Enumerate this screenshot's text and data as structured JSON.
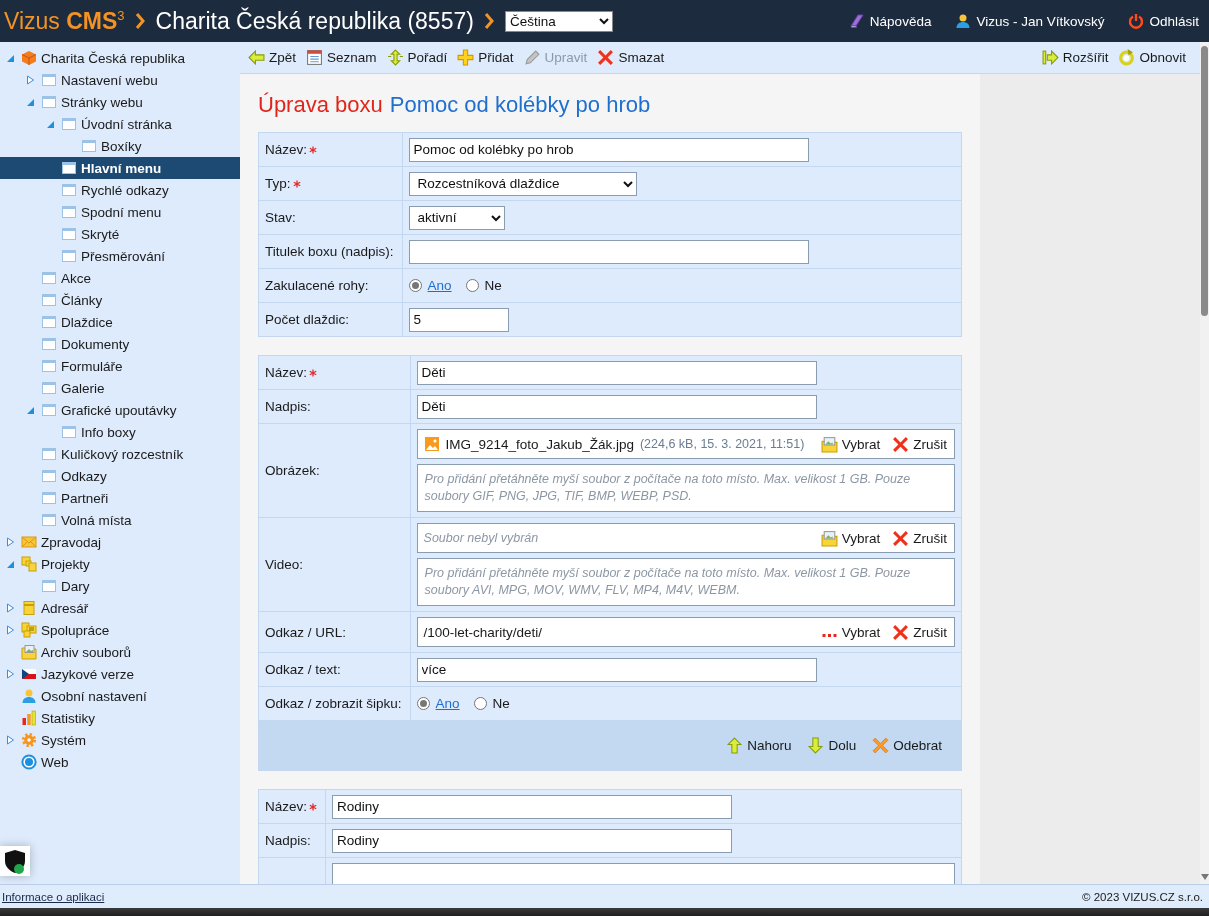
{
  "header": {
    "logo": "Vizus **CMS**$^{3}$",
    "site": "Charita Česká republika (8557)",
    "language": "Čeština",
    "links": [
      {
        "label": "Nápověda",
        "kind": "help"
      },
      {
        "label": "Vizus - Jan Vítkovský",
        "kind": "user"
      },
      {
        "label": "Odhlásit",
        "kind": "logout"
      }
    ]
  },
  "sidebar": {
    "items": [
      {
        "label": "Charita Česká republika",
        "kind": "cube",
        "expanded": true,
        "selected": false,
        "children": [
          {
            "label": "Nastavení webu",
            "kind": "page",
            "expanded": false,
            "selected": false
          },
          {
            "label": "Stránky webu",
            "kind": "page",
            "expanded": true,
            "selected": false,
            "children": [
              {
                "label": "Úvodní stránka",
                "kind": "page",
                "expanded": true,
                "selected": false,
                "children": [
                  {
                    "label": "Boxíky",
                    "kind": "page",
                    "selected": false
                  }
                ]
              },
              {
                "label": "Hlavní menu",
                "kind": "page",
                "selected": true
              },
              {
                "label": "Rychlé odkazy",
                "kind": "page",
                "selected": false
              },
              {
                "label": "Spodní menu",
                "kind": "page",
                "selected": false
              },
              {
                "label": "Skryté",
                "kind": "page",
                "selected": false
              },
              {
                "label": "Přesměrování",
                "kind": "page",
                "selected": false
              }
            ]
          },
          {
            "label": "Akce",
            "kind": "page",
            "selected": false
          },
          {
            "label": "Články",
            "kind": "page",
            "selected": false
          },
          {
            "label": "Dlaždice",
            "kind": "page",
            "selected": false
          },
          {
            "label": "Dokumenty",
            "kind": "page",
            "selected": false
          },
          {
            "label": "Formuláře",
            "kind": "page",
            "selected": false
          },
          {
            "label": "Galerie",
            "kind": "page",
            "selected": false
          },
          {
            "label": "Grafické upoutávky",
            "kind": "page",
            "expanded": true,
            "selected": false,
            "children": [
              {
                "label": "Info boxy",
                "kind": "page",
                "selected": false
              }
            ]
          },
          {
            "label": "Kuličkový rozcestník",
            "kind": "page",
            "selected": false
          },
          {
            "label": "Odkazy",
            "kind": "page",
            "selected": false
          },
          {
            "label": "Partneři",
            "kind": "page",
            "selected": false
          },
          {
            "label": "Volná místa",
            "kind": "page",
            "selected": false
          }
        ]
      },
      {
        "label": "Zpravodaj",
        "kind": "mail",
        "expanded": false,
        "selected": false
      },
      {
        "label": "Projekty",
        "kind": "projects",
        "expanded": true,
        "selected": false,
        "children": [
          {
            "label": "Dary",
            "kind": "page",
            "selected": false
          }
        ]
      },
      {
        "label": "Adresář",
        "kind": "address",
        "expanded": false,
        "selected": false
      },
      {
        "label": "Spolupráce",
        "kind": "collab",
        "expanded": false,
        "selected": false
      },
      {
        "label": "Archiv souborů",
        "kind": "archive",
        "selected": false
      },
      {
        "label": "Jazykové verze",
        "kind": "flag",
        "expanded": false,
        "selected": false
      },
      {
        "label": "Osobní nastavení",
        "kind": "person",
        "selected": false
      },
      {
        "label": "Statistiky",
        "kind": "stats",
        "selected": false
      },
      {
        "label": "Systém",
        "kind": "gear",
        "expanded": false,
        "selected": false
      },
      {
        "label": "Web",
        "kind": "web",
        "selected": false
      }
    ]
  },
  "toolbar": {
    "left": [
      {
        "label": "Zpět",
        "kind": "back",
        "disabled": false
      },
      {
        "label": "Seznam",
        "kind": "list",
        "disabled": false
      },
      {
        "label": "Pořadí",
        "kind": "order",
        "disabled": false
      },
      {
        "label": "Přidat",
        "kind": "add",
        "disabled": false
      },
      {
        "label": "Upravit",
        "kind": "edit",
        "disabled": true
      },
      {
        "label": "Smazat",
        "kind": "delete",
        "disabled": false
      }
    ],
    "right": [
      {
        "label": "Rozšířit",
        "kind": "expand",
        "disabled": false
      },
      {
        "label": "Obnovit",
        "kind": "refresh",
        "disabled": false
      }
    ]
  },
  "heading": {
    "action": "Úprava boxu",
    "subject": "Pomoc od kolébky po hrob"
  },
  "sections": [
    {
      "rows": [
        {
          "label": "Název:",
          "required": true,
          "kind": "text",
          "value": "Pomoc od kolébky po hrob"
        },
        {
          "label": "Typ:",
          "required": true,
          "kind": "select",
          "value": "Rozcestníková dlaždice"
        },
        {
          "label": "Stav:",
          "required": false,
          "kind": "select",
          "value": "aktivní"
        },
        {
          "label": "Titulek boxu (nadpis):",
          "required": false,
          "kind": "text"
        },
        {
          "label": "Zakulacené rohy:",
          "required": false,
          "kind": "radio",
          "options": [
            {
              "label": "Ano",
              "selected": true
            },
            {
              "label": "Ne",
              "selected": false
            }
          ]
        },
        {
          "label": "Počet dlaždic:",
          "required": false,
          "kind": "number",
          "value": "5"
        }
      ]
    },
    {
      "rows": [
        {
          "label": "Název:",
          "required": true,
          "kind": "text",
          "value": "Děti"
        },
        {
          "label": "Nadpis:",
          "required": false,
          "kind": "text",
          "value": "Děti"
        },
        {
          "label": "Obrázek:",
          "required": false,
          "kind": "file",
          "file_name": "IMG_9214_foto_Jakub_Žák.jpg",
          "file_meta": "(224,6 kB, 15. 3. 2021, 11:51)",
          "buttons": [
            {
              "label": "Vybrat",
              "kind": "folder"
            },
            {
              "label": "Zrušit",
              "kind": "delete"
            }
          ],
          "drop_hint": "Pro přidání přetáhněte myší soubor z počítače na toto místo. Max. velikost 1 GB. Pouze soubory GIF, PNG, JPG, TIF, BMP, WEBP, PSD."
        },
        {
          "label": "Video:",
          "required": false,
          "kind": "file",
          "placeholder": "Soubor nebyl vybrán",
          "buttons": [
            {
              "label": "Vybrat",
              "kind": "folder"
            },
            {
              "label": "Zrušit",
              "kind": "delete"
            }
          ],
          "drop_hint": "Pro přidání přetáhněte myší soubor z počítače na toto místo. Max. velikost 1 GB. Pouze soubory AVI, MPG, MOV, WMV, FLV, MP4, M4V, WEBM."
        },
        {
          "label": "Odkaz / URL:",
          "required": false,
          "kind": "url",
          "value": "/100-let-charity/deti/",
          "buttons": [
            {
              "label": "Vybrat",
              "kind": "dots"
            },
            {
              "label": "Zrušit",
              "kind": "delete"
            }
          ]
        },
        {
          "label": "Odkaz / text:",
          "required": false,
          "kind": "text",
          "value": "více"
        },
        {
          "label": "Odkaz / zobrazit šipku:",
          "required": false,
          "kind": "radio",
          "options": [
            {
              "label": "Ano",
              "selected": true
            },
            {
              "label": "Ne",
              "selected": false
            }
          ]
        }
      ],
      "actions": [
        {
          "label": "Nahoru",
          "kind": "up"
        },
        {
          "label": "Dolu",
          "kind": "down"
        },
        {
          "label": "Odebrat",
          "kind": "remove"
        }
      ]
    },
    {
      "rows": [
        {
          "label": "Název:",
          "required": true,
          "kind": "text",
          "value": "Rodiny"
        },
        {
          "label": "Nadpis:",
          "required": false,
          "kind": "text",
          "value": "Rodiny"
        },
        {
          "kind": "file"
        }
      ]
    }
  ],
  "footer": {
    "link": "Informace o aplikaci",
    "copyright": "© 2023 VIZUS.CZ s.r.o."
  }
}
